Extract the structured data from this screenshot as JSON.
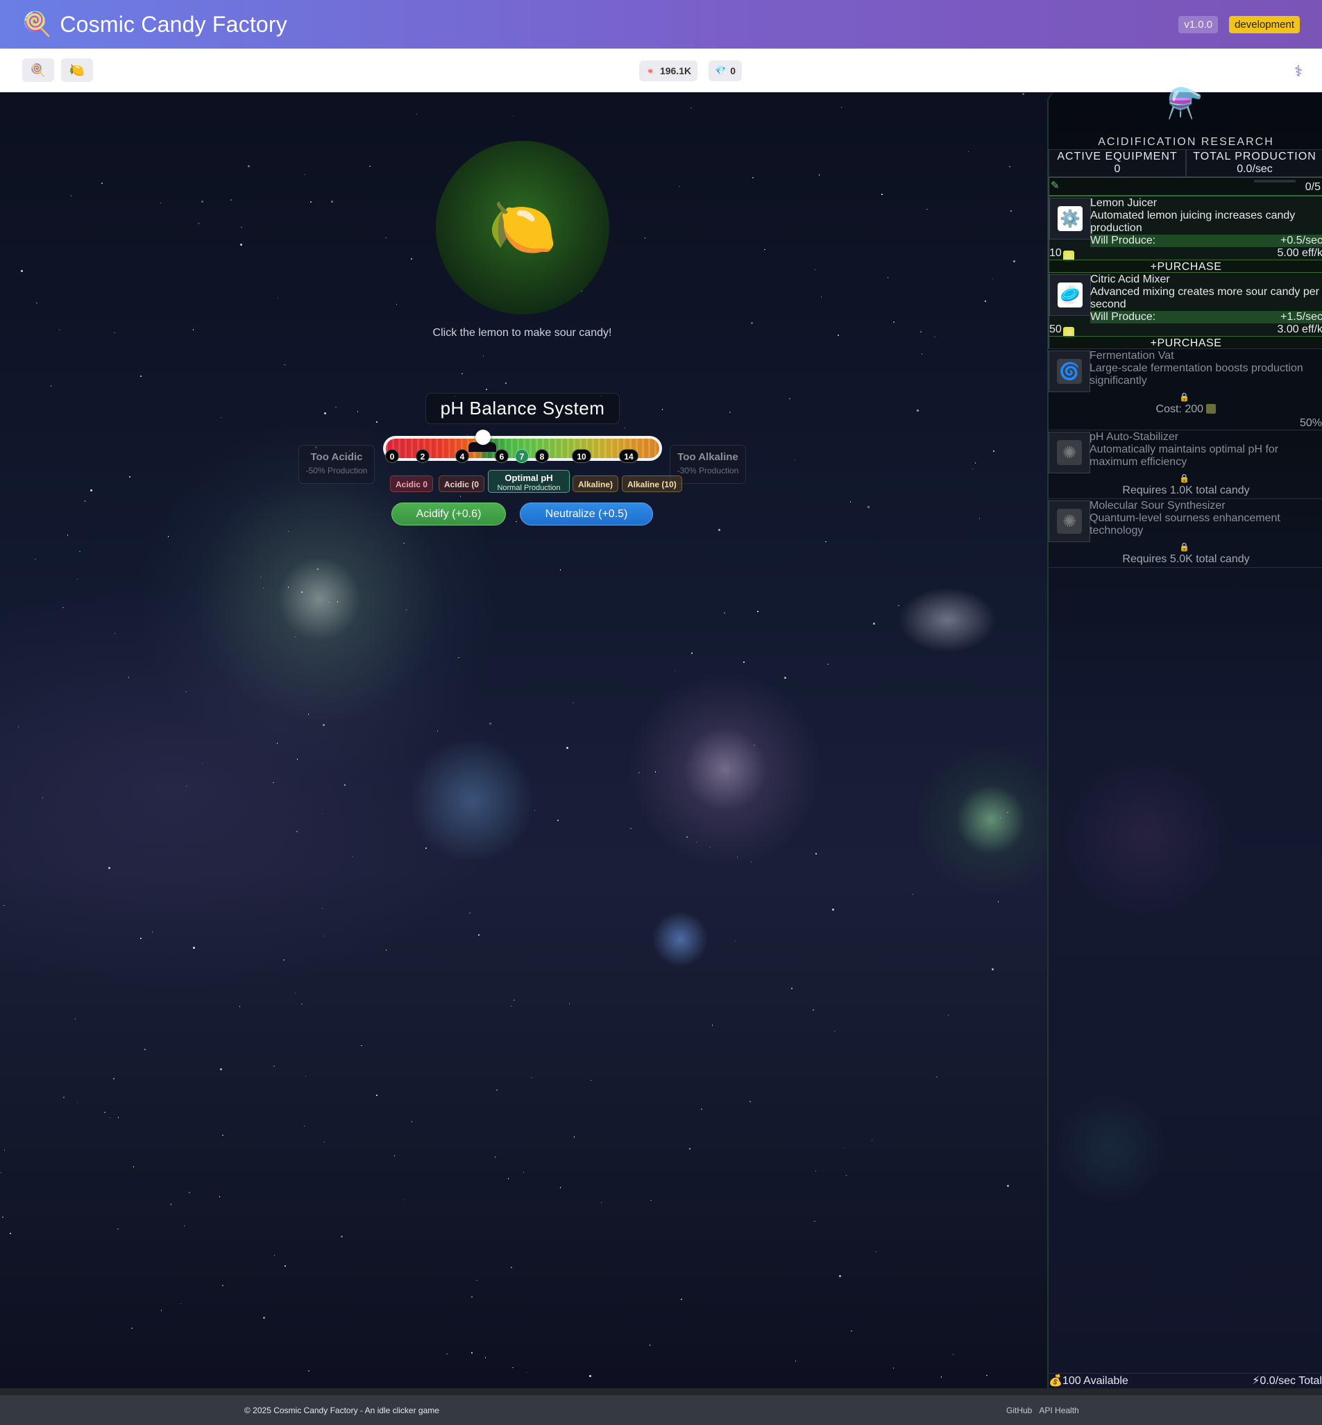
{
  "header": {
    "logo_glyph": "🍭",
    "title": "Cosmic Candy Factory",
    "version": "v1.0.0",
    "environment": "development"
  },
  "toolbar": {
    "tab_candy_glyph": "🍭",
    "tab_lemon_glyph": "🍋",
    "candy_count": "196.1K",
    "candy_icon": "🍬",
    "gem_count": "0",
    "gem_icon": "💎",
    "menu_icon": "⚕"
  },
  "lemon": {
    "glyph": "🍋",
    "hint": "Click the lemon to make sour candy!"
  },
  "ph": {
    "title": "pH Balance System",
    "current_value": 5.0,
    "markers": [
      "0",
      "2",
      "4",
      "6",
      "7",
      "8",
      "10",
      "14"
    ],
    "active_marker": "7",
    "too_acidic": {
      "title": "Too Acidic",
      "sub": "-50% Production"
    },
    "too_alkaline": {
      "title": "Too Alkaline",
      "sub": "-30% Production"
    },
    "zones": {
      "acidic_0": "Acidic 0",
      "acidic_partial": "Acidic (0",
      "optimal_title": "Optimal pH",
      "optimal_sub": "Normal Production",
      "alkaline_partial": "Alkaline)",
      "alkaline_10": "Alkaline (10)"
    },
    "acidify_label": "Acidify (+0.6)",
    "neutralize_label": "Neutralize (+0.5)"
  },
  "panel": {
    "flask_glyph": "⚗️",
    "title": "ACIDIFICATION RESEARCH",
    "active_equipment_label": "ACTIVE EQUIPMENT",
    "active_equipment_value": "0",
    "total_production_label": "TOTAL PRODUCTION",
    "total_production_value": "0.0/sec",
    "slots": "0/5",
    "slots_fill": 0,
    "items": [
      {
        "name": "Lemon Juicer",
        "desc": "Automated lemon juicing increases candy production",
        "will_label": "Will Produce:",
        "rate": "+0.5/sec",
        "cost": "10",
        "eff": "5.00 eff/k",
        "purchase": "+PURCHASE",
        "icon": "⚙️"
      },
      {
        "name": "Citric Acid Mixer",
        "desc": "Advanced mixing creates more sour candy per second",
        "will_label": "Will Produce:",
        "rate": "+1.5/sec",
        "cost": "50",
        "eff": "3.00 eff/k",
        "purchase": "+PURCHASE",
        "icon": "🥏"
      },
      {
        "name": "Fermentation Vat",
        "desc": "Large-scale fermentation boosts production significantly",
        "note": "Cost: 200",
        "pct": "50%",
        "icon": "🌀"
      },
      {
        "name": "pH Auto-Stabilizer",
        "desc": "Automatically maintains optimal pH for maximum efficiency",
        "note": "Requires 1.0K total candy",
        "icon": "✺"
      },
      {
        "name": "Molecular Sour Synthesizer",
        "desc": "Quantum-level sourness enhancement technology",
        "note": "Requires 5.0K total candy",
        "icon": "✺"
      }
    ],
    "footer_available": "💰100 Available",
    "footer_total": "⚡0.0/sec Total"
  },
  "footer": {
    "copyright": "© 2025 Cosmic Candy Factory - An idle clicker game",
    "link_github": "GitHub",
    "link_api": "API Health"
  }
}
